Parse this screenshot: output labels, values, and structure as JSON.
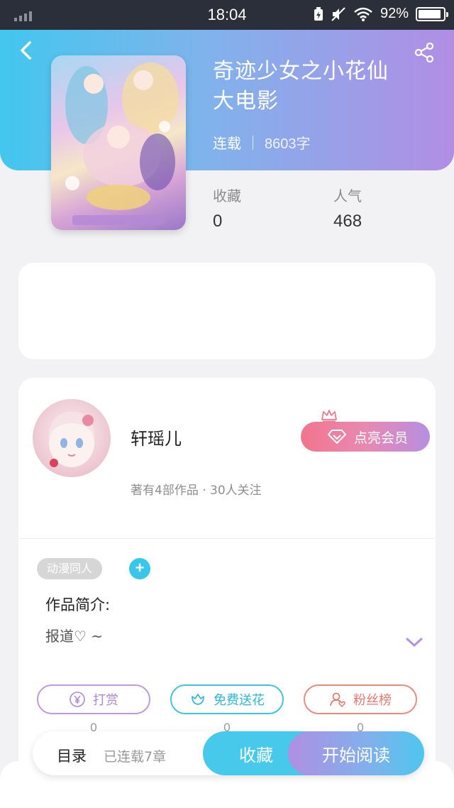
{
  "status_bar": {
    "time": "18:04",
    "battery": "92%",
    "battery_level": 0.92
  },
  "book": {
    "title_line1": "奇迹少女之小花仙",
    "title_line2": "大电影",
    "status": "连载",
    "word_count": "8603字",
    "favorites_label": "收藏",
    "favorites_value": "0",
    "popularity_label": "人气",
    "popularity_value": "468"
  },
  "author": {
    "name": "轩瑶儿",
    "summary": "著有4部作品 · 30人关注",
    "vip_button": "点亮会员"
  },
  "details": {
    "tag": "动漫同人",
    "add_tag_symbol": "+",
    "intro_label": "作品简介:",
    "intro_text": "报道♡ ~"
  },
  "actions": [
    {
      "label": "打赏",
      "count": "0",
      "icon": "yen-coin-icon"
    },
    {
      "label": "免费送花",
      "count": "0",
      "icon": "flower-icon"
    },
    {
      "label": "粉丝榜",
      "count": "0",
      "icon": "fan-ranking-icon"
    }
  ],
  "bottom_bar": {
    "toc": "目录",
    "chapters": "已连载7章",
    "collect": "收藏",
    "read": "开始阅读"
  },
  "colors": {
    "accent_blue": "#42c7ee",
    "accent_purple": "#b18ee4",
    "vip_pink": "#f1758e"
  }
}
